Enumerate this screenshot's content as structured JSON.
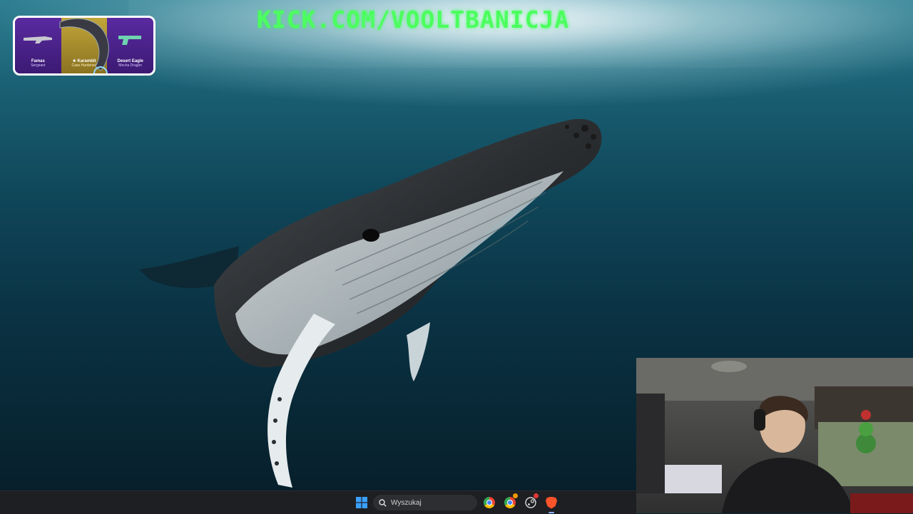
{
  "overlay": {
    "stream_url": "KICK.COM/VOOLTBANICJA"
  },
  "case_widget": {
    "items": [
      {
        "name": "Famas",
        "skin": "Sergeant"
      },
      {
        "name": "★ Karambit",
        "skin": "Case Hardened"
      },
      {
        "name": "Desert Eagle",
        "skin": "Mecha Dragon"
      }
    ]
  },
  "taskbar": {
    "search_placeholder": "Wyszukaj",
    "icons": [
      "windows-start-icon",
      "search-icon",
      "chrome-icon",
      "chrome-icon",
      "steam-icon",
      "brave-icon"
    ],
    "badge_colors": {
      "chrome_alt": "#f29900",
      "steam": "#e53935"
    }
  },
  "colors": {
    "kick_green": "#4cff5e",
    "taskbar_bg": "#1e1f22"
  }
}
